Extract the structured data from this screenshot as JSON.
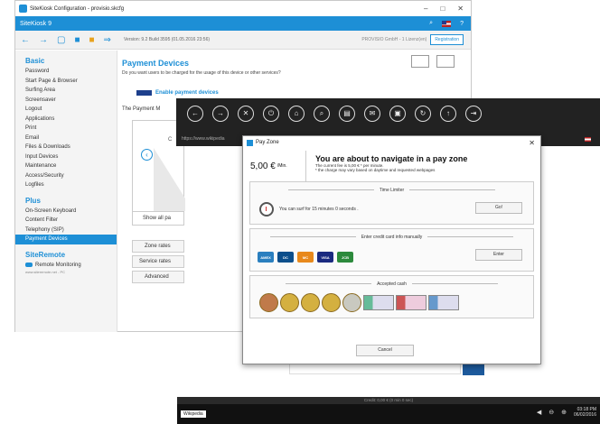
{
  "config": {
    "window_title": "SiteKiosk Configuration - provisio.skcfg",
    "app_name": "SiteKiosk 9",
    "version": "Version: 9.2 Build 3595 (01.05.2016 23:56)",
    "license": "PROVISIO GmbH - 1 Lizenz(en)",
    "register_label": "Registration",
    "sidebar": {
      "basic_title": "Basic",
      "basic_items": [
        "Password",
        "Start Page & Browser",
        "Surfing Area",
        "Screensaver",
        "Logout",
        "Applications",
        "Print",
        "Email",
        "Files & Downloads",
        "Input Devices",
        "Maintenance",
        "Access/Security",
        "Logfiles"
      ],
      "plus_title": "Plus",
      "plus_items": [
        "On-Screen Keyboard",
        "Content Filter",
        "Telephony (SIP)",
        "Payment Devices"
      ],
      "remote_title": "SiteRemote",
      "remote_item": "Remote Monitoring",
      "remote_url": "www.siteremote.net - PC"
    },
    "main": {
      "title": "Payment Devices",
      "subtitle": "Do you want users to be charged for the usage of this device or other services?",
      "enable_label": "Enable payment devices",
      "payment_text": "The Payment M",
      "card_letter": "C",
      "show_all": "Show all pa",
      "tabs": [
        "Zone rates",
        "Service rates",
        "Advanced"
      ]
    }
  },
  "kiosk": {
    "url": "https://www.wikipedia",
    "buttons": [
      "back-icon",
      "forward-icon",
      "close-icon",
      "power-icon",
      "home-icon",
      "search-icon",
      "print-icon",
      "mail-icon",
      "screen-icon",
      "refresh-icon",
      "upload-icon",
      "exit-icon"
    ],
    "credit": "Credit: 0,00 € (0 min 0 sec)",
    "tab": "Wikipedia",
    "time": "03:18 PM",
    "date": "06/02/2016"
  },
  "payzone": {
    "title": "Pay Zone",
    "fee": "5,00 €",
    "fee_unit": "/Min.",
    "headline": "You are about to navigate in a pay zone",
    "sub1": "The current fee is 5,00 € * per minute.",
    "sub2": "* the charge may vary based on daytime and requested webpages",
    "time_limiter": "Time Limiter",
    "surf_text": "You can surf for 15 minutes 0 seconds .",
    "go": "Go!",
    "card_title": "Enter credit card info manually",
    "enter": "Enter",
    "card_brands": [
      "AMEX",
      "DC",
      "MC",
      "VISA",
      "JCB"
    ],
    "cash_title": "Accepted cash",
    "cancel": "Cancel"
  }
}
